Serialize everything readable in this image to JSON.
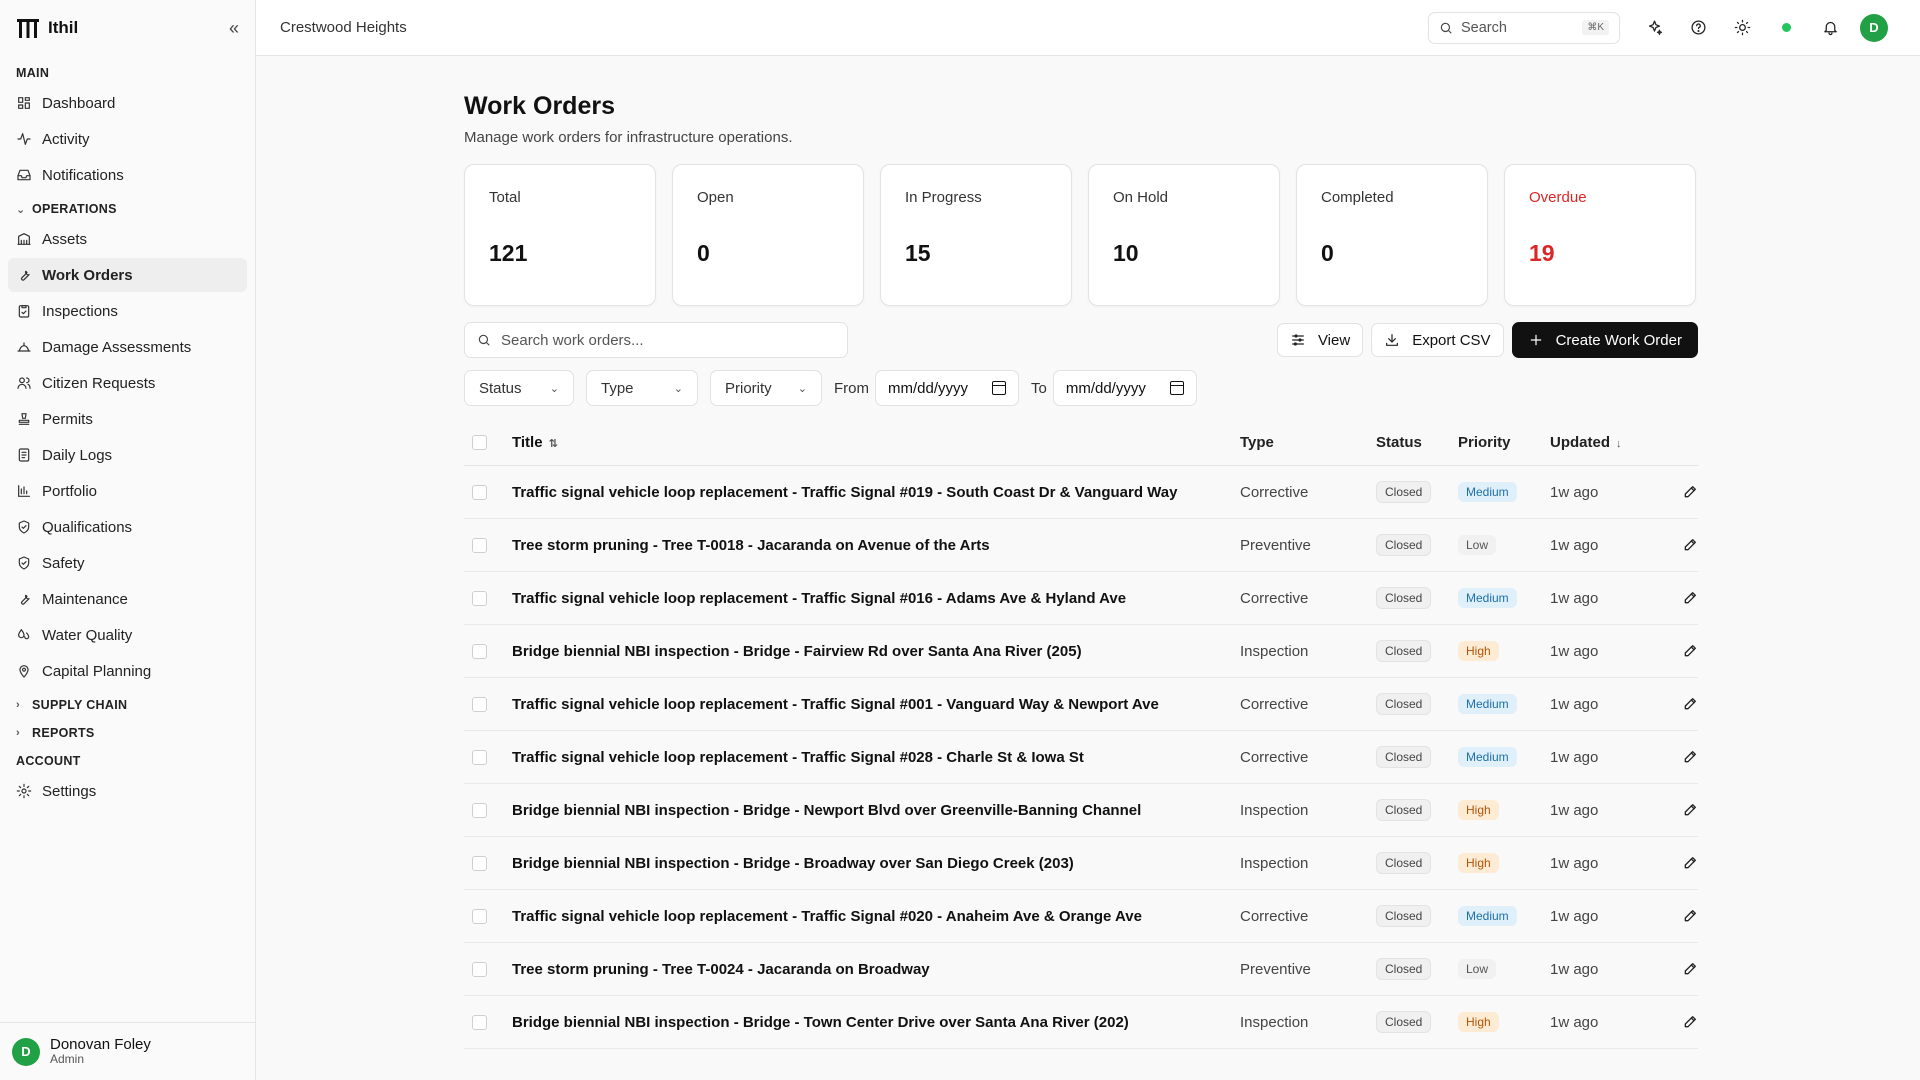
{
  "app": {
    "name": "Ithil",
    "org": "Crestwood Heights"
  },
  "sidebar": {
    "sections": {
      "main": "MAIN",
      "operations": "OPERATIONS",
      "supply_chain": "SUPPLY CHAIN",
      "reports": "REPORTS",
      "account": "ACCOUNT"
    },
    "main_items": [
      {
        "label": "Dashboard",
        "icon": "layout-grid-icon"
      },
      {
        "label": "Activity",
        "icon": "activity-icon"
      },
      {
        "label": "Notifications",
        "icon": "inbox-icon"
      }
    ],
    "operations_items": [
      {
        "label": "Assets",
        "icon": "building-icon"
      },
      {
        "label": "Work Orders",
        "icon": "wrench-icon",
        "active": true
      },
      {
        "label": "Inspections",
        "icon": "clipboard-check-icon"
      },
      {
        "label": "Damage Assessments",
        "icon": "damage-icon"
      },
      {
        "label": "Citizen Requests",
        "icon": "users-icon"
      },
      {
        "label": "Permits",
        "icon": "stamp-icon"
      },
      {
        "label": "Daily Logs",
        "icon": "notebook-icon"
      },
      {
        "label": "Portfolio",
        "icon": "portfolio-icon"
      },
      {
        "label": "Qualifications",
        "icon": "shield-check-icon"
      },
      {
        "label": "Safety",
        "icon": "shield-check-icon"
      },
      {
        "label": "Maintenance",
        "icon": "wrench-icon"
      },
      {
        "label": "Water Quality",
        "icon": "droplets-icon"
      },
      {
        "label": "Capital Planning",
        "icon": "map-pin-icon"
      }
    ],
    "account_items": [
      {
        "label": "Settings",
        "icon": "gear-icon"
      }
    ],
    "user": {
      "initial": "D",
      "name": "Donovan Foley",
      "role": "Admin"
    }
  },
  "topbar": {
    "search_placeholder": "Search",
    "search_shortcut": "⌘K",
    "avatar_initial": "D",
    "status_color": "#22c55e"
  },
  "page": {
    "title": "Work Orders",
    "subtitle": "Manage work orders for infrastructure operations."
  },
  "stats": [
    {
      "label": "Total",
      "value": "121"
    },
    {
      "label": "Open",
      "value": "0"
    },
    {
      "label": "In Progress",
      "value": "15"
    },
    {
      "label": "On Hold",
      "value": "10"
    },
    {
      "label": "Completed",
      "value": "0"
    },
    {
      "label": "Overdue",
      "value": "19",
      "color": "#dc2626"
    }
  ],
  "toolbar": {
    "search_placeholder": "Search work orders...",
    "view_label": "View",
    "export_label": "Export CSV",
    "create_label": "Create Work Order"
  },
  "filters": {
    "status": "Status",
    "type": "Type",
    "priority": "Priority",
    "from_label": "From",
    "from_value": "mm/dd/yyyy",
    "to_label": "To",
    "to_value": "mm/dd/yyyy"
  },
  "table": {
    "headers": {
      "title": "Title",
      "type": "Type",
      "status": "Status",
      "priority": "Priority",
      "updated": "Updated"
    },
    "rows": [
      {
        "title": "Traffic signal vehicle loop replacement - Traffic Signal #019 - South Coast Dr & Vanguard Way",
        "type": "Corrective",
        "status": "Closed",
        "priority": "Medium",
        "updated": "1w ago"
      },
      {
        "title": "Tree storm pruning - Tree T-0018 - Jacaranda on Avenue of the Arts",
        "type": "Preventive",
        "status": "Closed",
        "priority": "Low",
        "updated": "1w ago"
      },
      {
        "title": "Traffic signal vehicle loop replacement - Traffic Signal #016 - Adams Ave & Hyland Ave",
        "type": "Corrective",
        "status": "Closed",
        "priority": "Medium",
        "updated": "1w ago"
      },
      {
        "title": "Bridge biennial NBI inspection - Bridge - Fairview Rd over Santa Ana River (205)",
        "type": "Inspection",
        "status": "Closed",
        "priority": "High",
        "updated": "1w ago"
      },
      {
        "title": "Traffic signal vehicle loop replacement - Traffic Signal #001 - Vanguard Way & Newport Ave",
        "type": "Corrective",
        "status": "Closed",
        "priority": "Medium",
        "updated": "1w ago"
      },
      {
        "title": "Traffic signal vehicle loop replacement - Traffic Signal #028 - Charle St & Iowa St",
        "type": "Corrective",
        "status": "Closed",
        "priority": "Medium",
        "updated": "1w ago"
      },
      {
        "title": "Bridge biennial NBI inspection - Bridge - Newport Blvd over Greenville-Banning Channel",
        "type": "Inspection",
        "status": "Closed",
        "priority": "High",
        "updated": "1w ago"
      },
      {
        "title": "Bridge biennial NBI inspection - Bridge - Broadway over San Diego Creek (203)",
        "type": "Inspection",
        "status": "Closed",
        "priority": "High",
        "updated": "1w ago"
      },
      {
        "title": "Traffic signal vehicle loop replacement - Traffic Signal #020 - Anaheim Ave & Orange Ave",
        "type": "Corrective",
        "status": "Closed",
        "priority": "Medium",
        "updated": "1w ago"
      },
      {
        "title": "Tree storm pruning - Tree T-0024 - Jacaranda on Broadway",
        "type": "Preventive",
        "status": "Closed",
        "priority": "Low",
        "updated": "1w ago"
      },
      {
        "title": "Bridge biennial NBI inspection - Bridge - Town Center Drive over Santa Ana River (202)",
        "type": "Inspection",
        "status": "Closed",
        "priority": "High",
        "updated": "1w ago"
      }
    ]
  }
}
